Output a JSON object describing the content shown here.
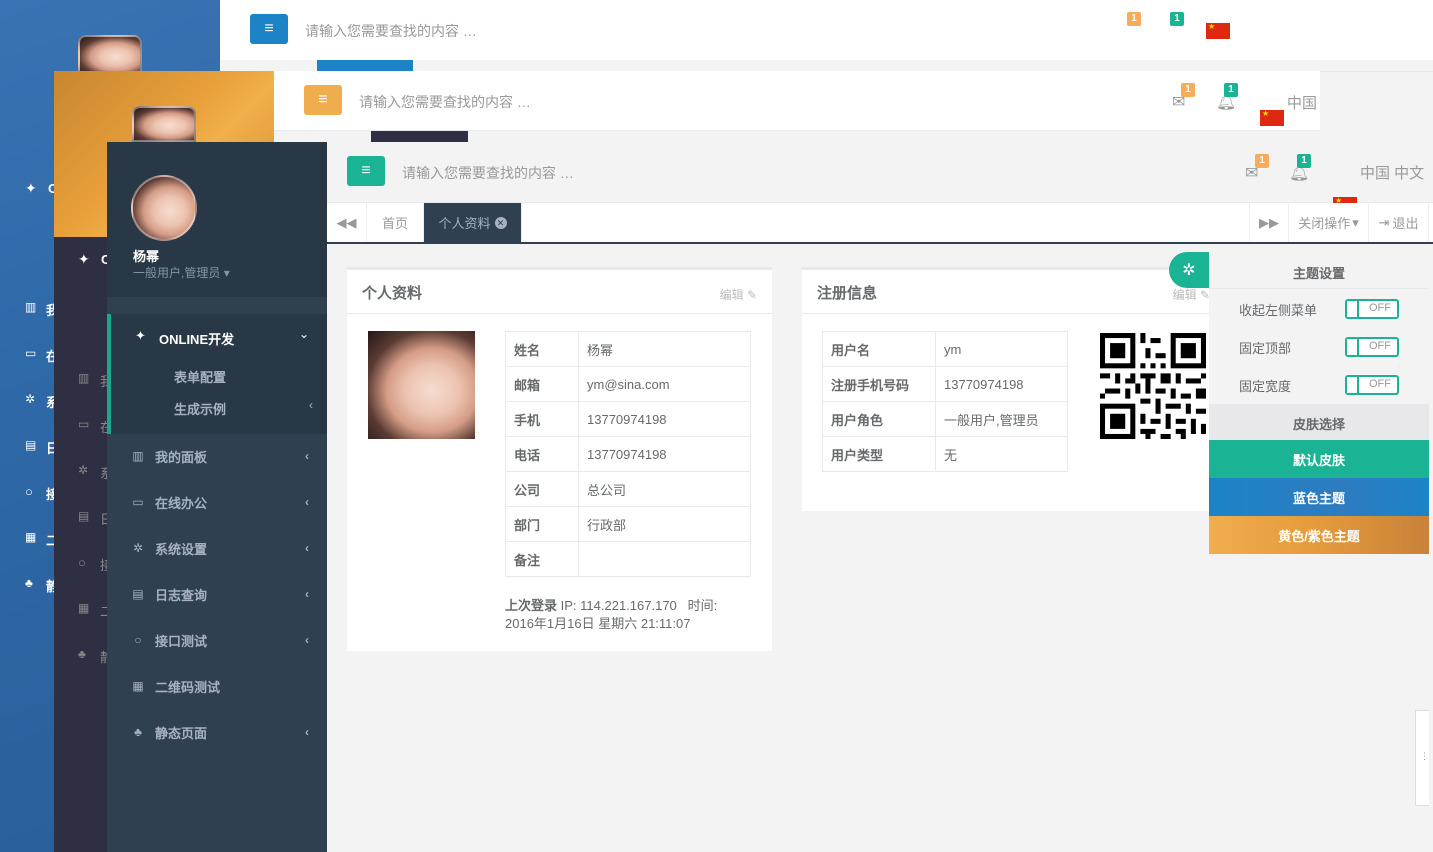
{
  "header": {
    "search_placeholder": "请输入您需要查找的内容 …",
    "mail_badge": "1",
    "bell_badge": "1",
    "lang_short": "中国",
    "lang_full": "中国 中文"
  },
  "user": {
    "name": "杨幂",
    "role": "一般用户,管理员"
  },
  "sidebar": {
    "active_group": "ONLINE开发",
    "sub_items": [
      "表单配置",
      "生成示例"
    ],
    "items": [
      "我的面板",
      "在线办公",
      "系统设置",
      "日志查询",
      "接口测试",
      "二维码测试",
      "静态页面"
    ],
    "back_items": [
      "O",
      "我",
      "在",
      "系",
      "日",
      "接",
      "二",
      "静"
    ]
  },
  "tabs": {
    "home": "首页",
    "profile": "个人资料",
    "close_ops": "关闭操作",
    "logout": "退出"
  },
  "profile_panel": {
    "title": "个人资料",
    "edit": "编辑",
    "rows": [
      {
        "k": "姓名",
        "v": "杨幂"
      },
      {
        "k": "邮箱",
        "v": "ym@sina.com"
      },
      {
        "k": "手机",
        "v": "13770974198"
      },
      {
        "k": "电话",
        "v": "13770974198"
      },
      {
        "k": "公司",
        "v": "总公司"
      },
      {
        "k": "部门",
        "v": "行政部"
      },
      {
        "k": "备注",
        "v": ""
      }
    ],
    "last_login_label": "上次登录",
    "last_login_ip": "IP: 114.221.167.170",
    "time_label": "时间:",
    "last_login_time": "2016年1月16日 星期六 21:11:07"
  },
  "register_panel": {
    "title": "注册信息",
    "edit": "编辑",
    "rows": [
      {
        "k": "用户名",
        "v": "ym"
      },
      {
        "k": "注册手机号码",
        "v": "13770974198"
      },
      {
        "k": "用户角色",
        "v": "一般用户,管理员"
      },
      {
        "k": "用户类型",
        "v": "无"
      }
    ]
  },
  "theme_settings": {
    "title": "主题设置",
    "options": [
      {
        "label": "收起左侧菜单",
        "state": "OFF"
      },
      {
        "label": "固定顶部",
        "state": "OFF"
      },
      {
        "label": "固定宽度",
        "state": "OFF"
      }
    ],
    "skin_title": "皮肤选择",
    "skins": [
      "默认皮肤",
      "蓝色主题",
      "黄色/紫色主题"
    ]
  },
  "colors": {
    "primary": "#1ab394",
    "sidebar": "#2f4050",
    "blue": "#1c84c6",
    "yellow": "#f0ad4e",
    "warning_badge": "#f8ac59"
  }
}
